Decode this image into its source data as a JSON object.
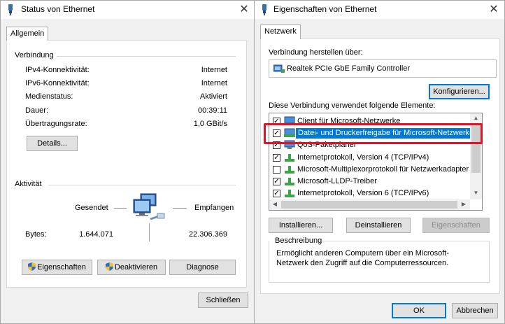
{
  "status_window": {
    "title": "Status von Ethernet",
    "tab": "Allgemein",
    "connection_group": "Verbindung",
    "rows": [
      {
        "label": "IPv4-Konnektivität:",
        "value": "Internet"
      },
      {
        "label": "IPv6-Konnektivität:",
        "value": "Internet"
      },
      {
        "label": "Medienstatus:",
        "value": "Aktiviert"
      },
      {
        "label": "Dauer:",
        "value": "00:39:11"
      },
      {
        "label": "Übertragungsrate:",
        "value": "1,0 GBit/s"
      }
    ],
    "details_button": "Details...",
    "activity_group": "Aktivität",
    "sent_label": "Gesendet",
    "received_label": "Empfangen",
    "bytes_label": "Bytes:",
    "bytes_sent": "1.644.071",
    "bytes_received": "22.306.369",
    "properties_button": "Eigenschaften",
    "deactivate_button": "Deaktivieren",
    "diagnose_button": "Diagnose",
    "close_button": "Schließen"
  },
  "props_window": {
    "title": "Eigenschaften von Ethernet",
    "tab": "Netzwerk",
    "connect_using_label": "Verbindung herstellen über:",
    "adapter_name": "Realtek PCIe GbE Family Controller",
    "configure_button": "Konfigurieren...",
    "items_label": "Diese Verbindung verwendet folgende Elemente:",
    "items": [
      {
        "label": "Client für Microsoft-Netzwerke",
        "checked": true
      },
      {
        "label": "Datei- und Druckerfreigabe für Microsoft-Netzwerke",
        "checked": true,
        "selected": true
      },
      {
        "label": "QoS-Paketplaner",
        "checked": true
      },
      {
        "label": "Internetprotokoll, Version 4 (TCP/IPv4)",
        "checked": true
      },
      {
        "label": "Microsoft-Multiplexorprotokoll für Netzwerkadapter",
        "checked": false
      },
      {
        "label": "Microsoft-LLDP-Treiber",
        "checked": true
      },
      {
        "label": "Internetprotokoll, Version 6 (TCP/IPv6)",
        "checked": true
      }
    ],
    "install_button": "Installieren...",
    "uninstall_button": "Deinstallieren",
    "properties_button": "Eigenschaften",
    "description_group": "Beschreibung",
    "description_text": "Ermöglicht anderen Computern über ein Microsoft-Netzwerk den Zugriff auf die Computerressourcen.",
    "ok_button": "OK",
    "cancel_button": "Abbrechen"
  },
  "colors": {
    "selection": "#0078d7",
    "highlight_box": "#e81123",
    "dialog_bg": "#f0f0f0"
  },
  "icons": [
    "ethernet-icon",
    "network-computers-icon",
    "shield-icon",
    "network-adapter-icon",
    "client-icon",
    "share-icon",
    "protocol-icon",
    "close-icon",
    "chevron-up-icon",
    "chevron-down-icon",
    "chevron-left-icon",
    "chevron-right-icon"
  ]
}
